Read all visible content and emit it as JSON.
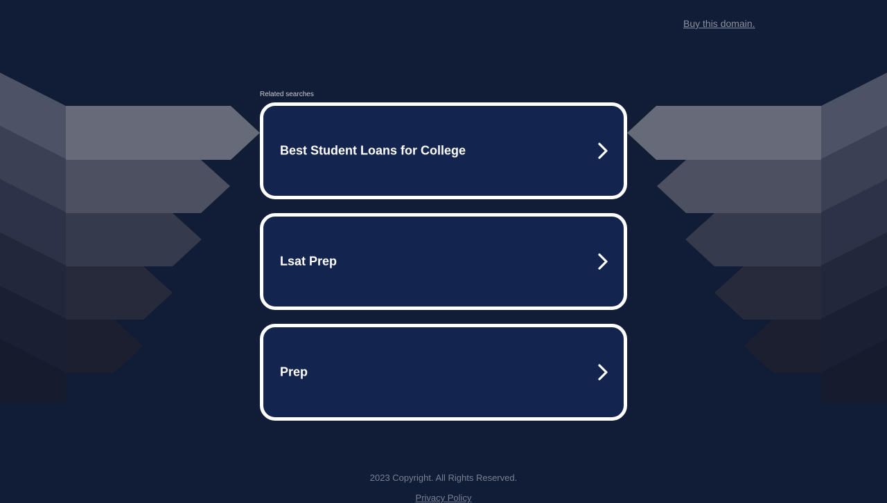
{
  "header": {
    "buy_link": "Buy this domain."
  },
  "related": {
    "label": "Related searches",
    "items": [
      {
        "label": "Best Student Loans for College",
        "icon": "chevron-right-icon"
      },
      {
        "label": "Lsat Prep",
        "icon": "chevron-right-icon"
      },
      {
        "label": "Prep",
        "icon": "chevron-right-icon"
      }
    ]
  },
  "footer": {
    "copyright": "2023 Copyright. All Rights Reserved.",
    "privacy": "Privacy Policy"
  },
  "colors": {
    "background": "#111c36",
    "card": "#13244e",
    "card_border": "#ffffff"
  }
}
